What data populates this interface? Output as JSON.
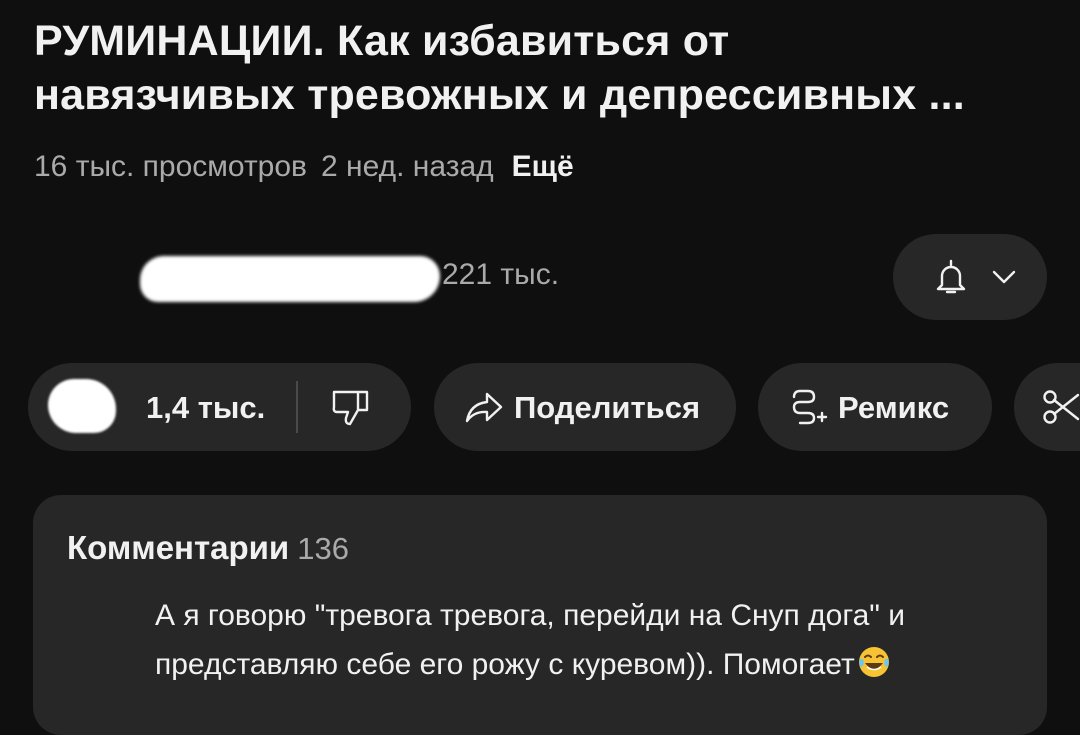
{
  "video": {
    "title_line1": "РУМИНАЦИИ. Как избавиться от",
    "title_line2": "навязчивых тревожных и депрессивных ...",
    "views": "16 тыс. просмотров",
    "age": "2 нед. назад",
    "more_label": "Ещё"
  },
  "channel": {
    "subscribers": "221 тыс.",
    "bell_icon": "bell-icon",
    "dropdown_icon": "chevron-down-icon"
  },
  "actions": {
    "like_count": "1,4 тыс.",
    "dislike_icon": "thumbs-down-icon",
    "share_label": "Поделиться",
    "share_icon": "share-arrow-icon",
    "remix_label": "Ремикс",
    "remix_icon": "remix-icon",
    "clip_icon": "scissors-icon"
  },
  "comments": {
    "title": "Комментарии",
    "count": "136",
    "top_comment_line1": "А я говорю \"тревога тревога, перейди на Снуп дога\" и",
    "top_comment_line2": "представляю себе его рожу с куревом)). Помогает",
    "emoji_icon": "laughing-tears-emoji-icon"
  },
  "colors": {
    "background": "#0f0f0f",
    "surface": "#272727",
    "text_primary": "#f1f1f1",
    "text_secondary": "#aaaaaa"
  }
}
